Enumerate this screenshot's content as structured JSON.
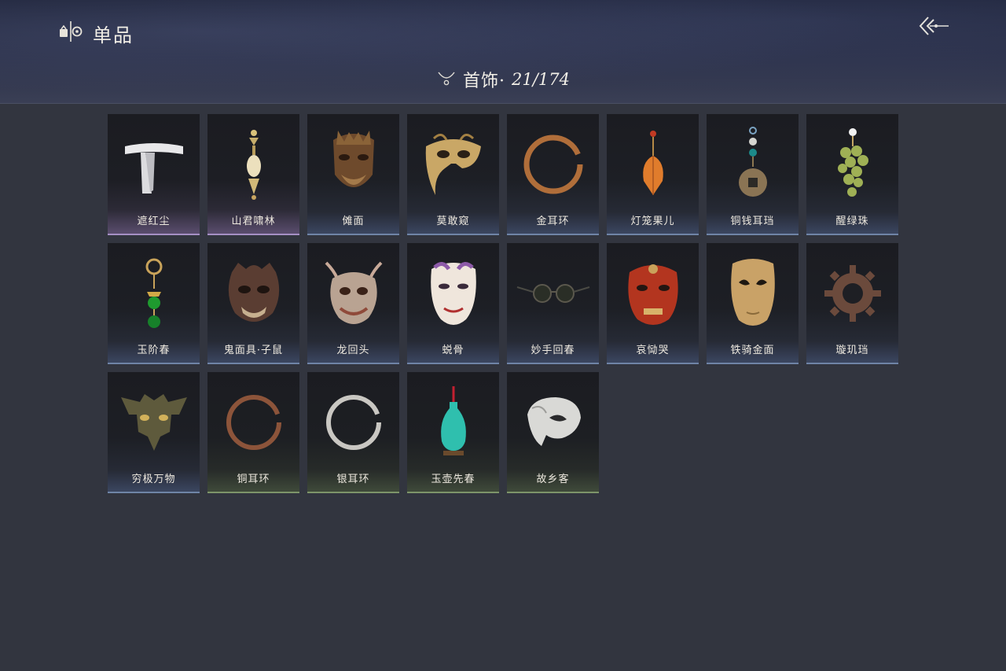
{
  "header": {
    "icon": "wardrobe-icon",
    "title": "单品",
    "back_icon": "back-arrow-icon"
  },
  "category": {
    "icon": "necklace-icon",
    "label": "首饰·",
    "count": "21/174"
  },
  "colors": {
    "background": "#32353f",
    "rarity_blue": "#6f84a6",
    "rarity_purple": "#a58fc4",
    "rarity_green": "#7d9469"
  },
  "items": [
    {
      "name": "遮红尘",
      "icon": "white-headband-icon",
      "rarity": "purple"
    },
    {
      "name": "山君啸林",
      "icon": "pendant-earring-icon",
      "rarity": "purple"
    },
    {
      "name": "傩面",
      "icon": "nuo-mask-icon",
      "rarity": "blue"
    },
    {
      "name": "莫敢窥",
      "icon": "golden-half-mask-icon",
      "rarity": "blue"
    },
    {
      "name": "金耳环",
      "icon": "gold-hoop-earring-icon",
      "rarity": "blue"
    },
    {
      "name": "灯笼果儿",
      "icon": "lantern-fruit-earring-icon",
      "rarity": "blue"
    },
    {
      "name": "铜钱耳珰",
      "icon": "coin-earring-icon",
      "rarity": "blue"
    },
    {
      "name": "醒绿珠",
      "icon": "green-grape-earring-icon",
      "rarity": "blue"
    },
    {
      "name": "玉阶春",
      "icon": "jade-bead-earring-icon",
      "rarity": "blue"
    },
    {
      "name": "鬼面具·子鼠",
      "icon": "rat-demon-mask-icon",
      "rarity": "blue"
    },
    {
      "name": "龙回头",
      "icon": "dragon-mask-icon",
      "rarity": "blue"
    },
    {
      "name": "蜕骨",
      "icon": "white-opera-mask-icon",
      "rarity": "blue"
    },
    {
      "name": "妙手回春",
      "icon": "spectacles-icon",
      "rarity": "blue"
    },
    {
      "name": "哀恸哭",
      "icon": "red-oni-mask-icon",
      "rarity": "blue"
    },
    {
      "name": "铁骑金面",
      "icon": "gold-face-mask-icon",
      "rarity": "blue"
    },
    {
      "name": "璇玑珰",
      "icon": "gear-ring-earring-icon",
      "rarity": "blue"
    },
    {
      "name": "穷极万物",
      "icon": "bronze-taotie-mask-icon",
      "rarity": "blue"
    },
    {
      "name": "铜耳环",
      "icon": "copper-hoop-earring-icon",
      "rarity": "green"
    },
    {
      "name": "银耳环",
      "icon": "silver-hoop-earring-icon",
      "rarity": "green"
    },
    {
      "name": "玉壶先春",
      "icon": "jade-vase-icon",
      "rarity": "green"
    },
    {
      "name": "故乡客",
      "icon": "white-phantom-mask-icon",
      "rarity": "green"
    }
  ]
}
